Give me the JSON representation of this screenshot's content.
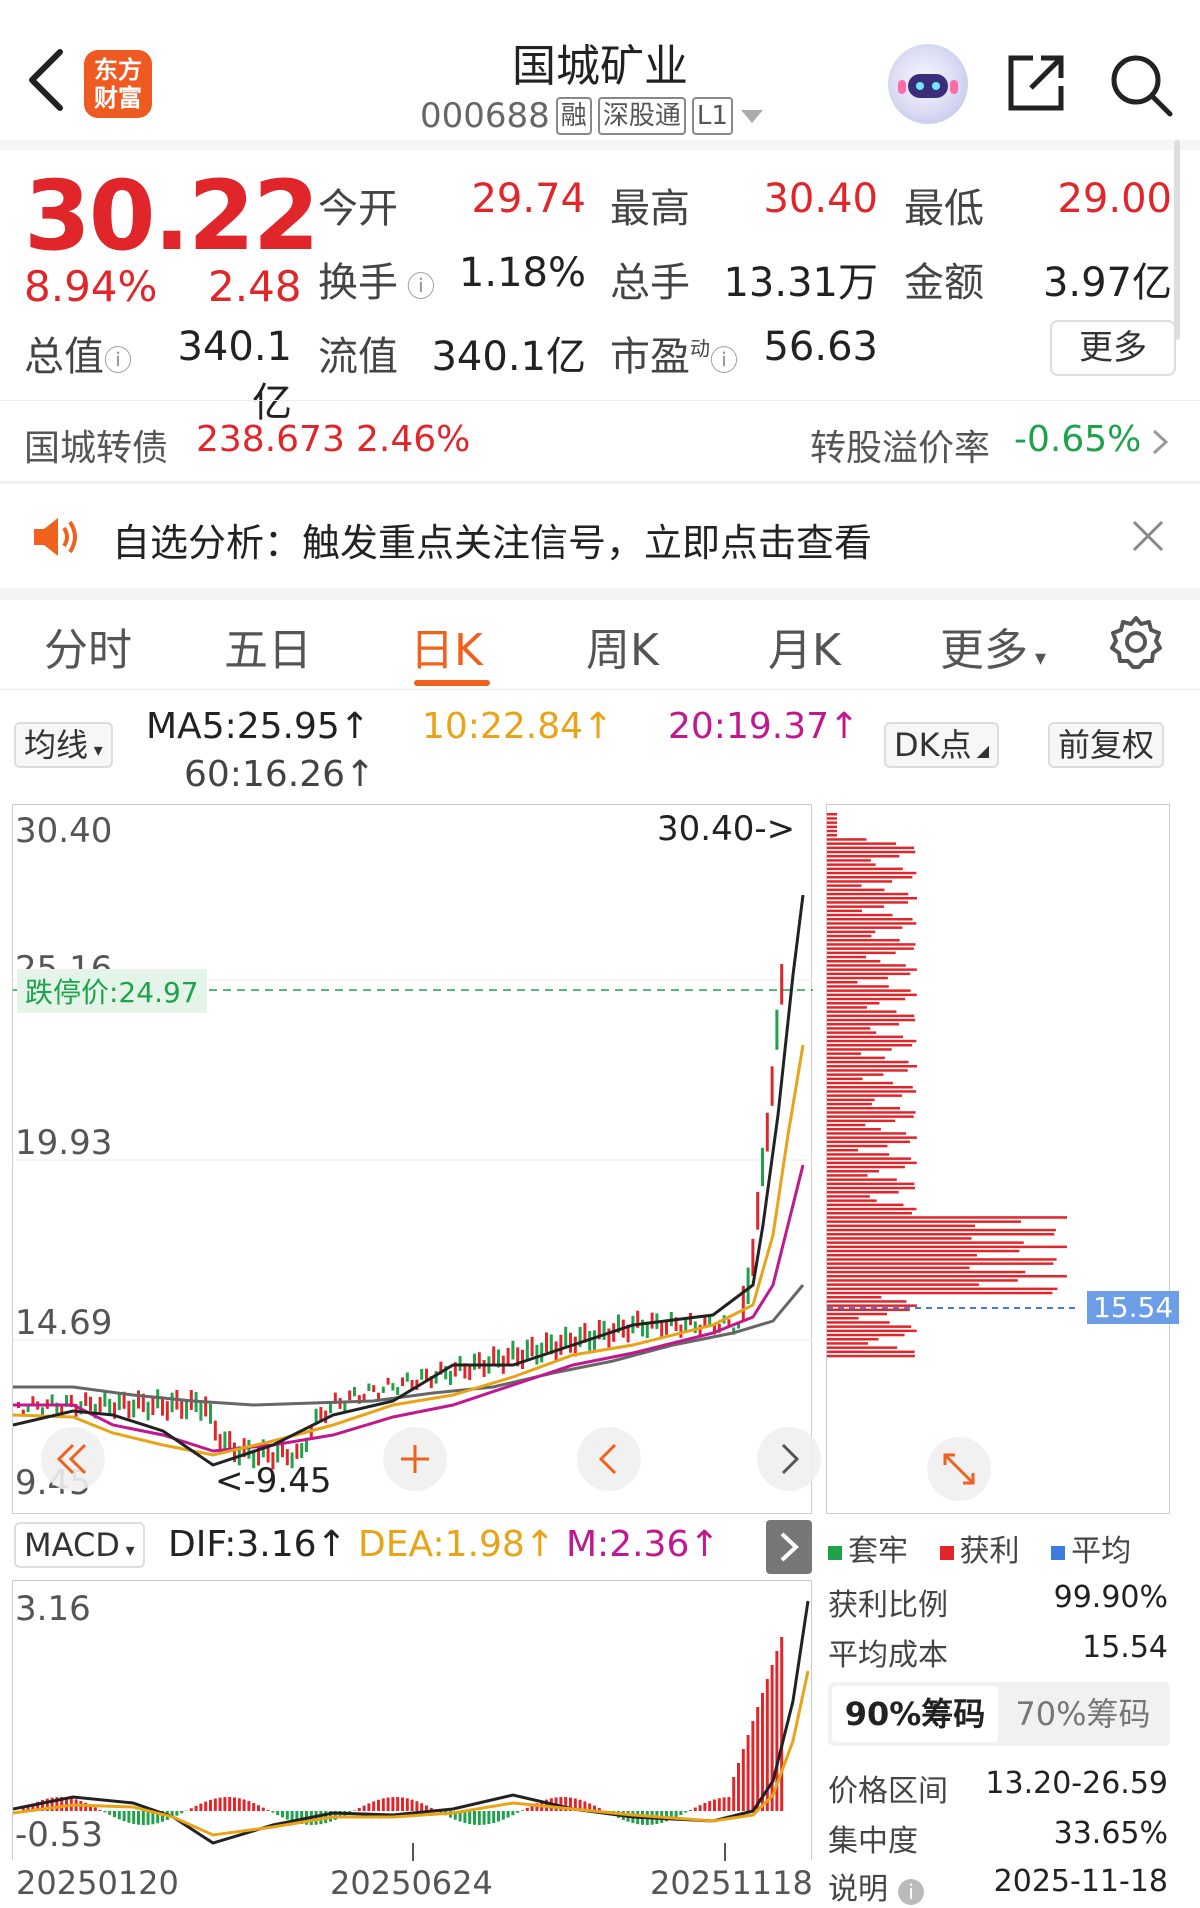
{
  "header": {
    "title": "国城矿业",
    "code": "000688",
    "tags": [
      "融",
      "深股通",
      "L1"
    ],
    "logo_text": "东方财富"
  },
  "quote": {
    "price": "30.22",
    "change_pct": "8.94%",
    "change": "2.48",
    "open_label": "今开",
    "open": "29.74",
    "high_label": "最高",
    "high": "30.40",
    "low_label": "最低",
    "low": "29.00",
    "turnover_label": "换手",
    "turnover": "1.18%",
    "volume_label": "总手",
    "volume": "13.31万",
    "amount_label": "金额",
    "amount": "3.97亿",
    "mcap_label": "总值",
    "mcap": "340.1亿",
    "float_label": "流值",
    "float": "340.1亿",
    "pe_label": "市盈",
    "pe_sup": "动",
    "pe": "56.63",
    "more_label": "更多"
  },
  "bond": {
    "name": "国城转债",
    "price": "238.673",
    "pct": "2.46%",
    "premium_label": "转股溢价率",
    "premium": "-0.65%"
  },
  "notice": {
    "text": "自选分析：触发重点关注信号，立即点击查看"
  },
  "tabs": [
    {
      "label": "分时"
    },
    {
      "label": "五日"
    },
    {
      "label": "日K"
    },
    {
      "label": "周K"
    },
    {
      "label": "月K"
    },
    {
      "label": "更多"
    }
  ],
  "ma": {
    "selector": "均线",
    "ma5": "MA5:25.95↑",
    "ma10": "10:22.84↑",
    "ma20": "20:19.37↑",
    "ma60": "60:16.26↑",
    "dk_label": "DK点",
    "adjust_label": "前复权"
  },
  "kchart": {
    "y_labels": [
      "30.40",
      "25.16",
      "19.93",
      "14.69",
      "9.45"
    ],
    "limit_down_label": "跌停价:24.97",
    "high_marker": "30.40->",
    "low_marker": "<-9.45",
    "cost_label": "15.54"
  },
  "macd": {
    "selector": "MACD",
    "dif": "DIF:3.16↑",
    "dea": "DEA:1.98↑",
    "m": "M:2.36↑",
    "y_top": "3.16",
    "y_bottom": "-0.53",
    "dates": [
      "20250120",
      "20250624",
      "20251118"
    ]
  },
  "chips": {
    "legend": [
      "套牢",
      "获利",
      "平均"
    ],
    "profit_ratio_label": "获利比例",
    "profit_ratio": "99.90%",
    "avg_cost_label": "平均成本",
    "avg_cost": "15.54",
    "tab_90": "90%筹码",
    "tab_70": "70%筹码",
    "range_label": "价格区间",
    "range": "13.20-26.59",
    "concentration_label": "集中度",
    "concentration": "33.65%",
    "note_label": "说明",
    "note_date": "2025-11-18"
  },
  "colors": {
    "up": "#e0262a",
    "down": "#1ea24a",
    "accent": "#f0611d",
    "ma5": "#222222",
    "ma10": "#e8a317",
    "ma20": "#c2188f",
    "ma60": "#666666"
  }
}
